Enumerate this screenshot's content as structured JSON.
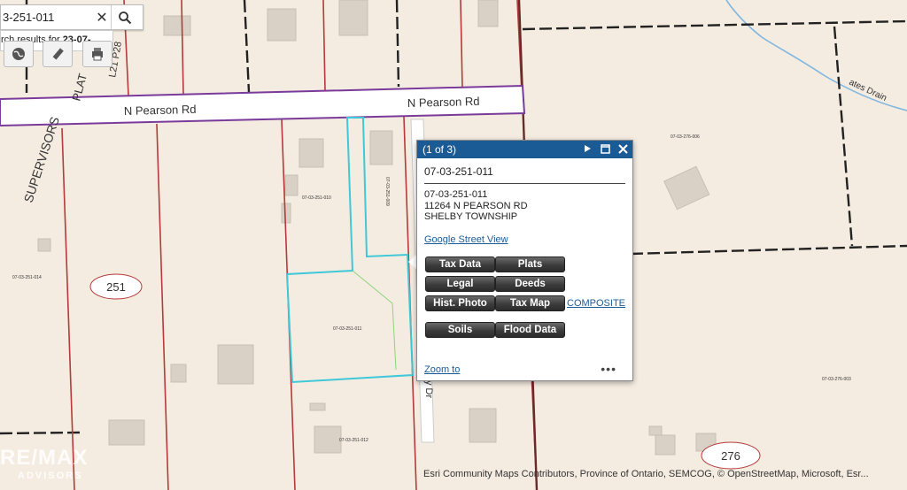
{
  "search": {
    "value": "3-251-011",
    "results_prefix": "rch results for ",
    "results_query": "23-07-..."
  },
  "toolbar": {
    "icons": [
      "globe-icon",
      "pencil-icon",
      "print-icon"
    ]
  },
  "map": {
    "roads": [
      {
        "label": "N Pearson Rd"
      },
      {
        "label": "N Pearson Rd"
      },
      {
        "label": "SUPERVISORS"
      },
      {
        "label": "PLAT"
      },
      {
        "label": "L21 P28"
      },
      {
        "label": "y Dr"
      },
      {
        "label": "ates Drain"
      }
    ],
    "section_badges": [
      "251",
      "276"
    ],
    "parcel_ids": [
      "07-03-251-010",
      "07-03-251-009",
      "07-03-251-011",
      "07-03-251-014",
      "07-03-251-012",
      "07-03-276-006",
      "07-03-276-003"
    ],
    "colors": {
      "background": "#f5ece1",
      "section_line": "#222222",
      "parcel_line": "#b53a3a",
      "road_boundary": "#7a3a9a",
      "selected_parcel": "#3fc8d8",
      "drain": "#7fb6e0",
      "building": "#d9d0c6",
      "popup_header": "#1b5b95"
    }
  },
  "popup": {
    "counter": "(1 of 3)",
    "title": "07-03-251-011",
    "parcel": "07-03-251-011",
    "address": "11264 N PEARSON RD",
    "township": "SHELBY TOWNSHIP",
    "google_street_view": "Google Street View",
    "buttons": {
      "tax_data": "Tax Data",
      "plats": "Plats",
      "legal": "Legal",
      "deeds": "Deeds",
      "hist_photo": "Hist. Photo",
      "tax_map": "Tax Map",
      "soils": "Soils",
      "flood_data": "Flood Data"
    },
    "composite": "COMPOSITE",
    "zoom_to": "Zoom to",
    "more": "•••"
  },
  "attribution": "Esri Community Maps Contributors, Province of Ontario, SEMCOG, © OpenStreetMap, Microsoft, Esr...",
  "watermark": {
    "brand": "RE/MAX",
    "sub": "ADVISORS"
  }
}
